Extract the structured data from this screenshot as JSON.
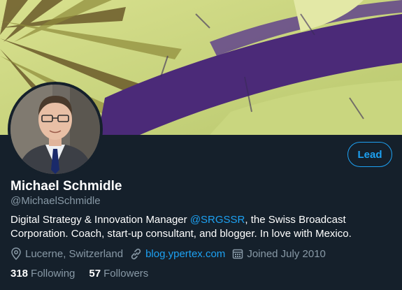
{
  "profile": {
    "name": "Michael Schmidle",
    "handle": "@MichaelSchmidle",
    "bio_before": "Digital Strategy & Innovation Manager ",
    "bio_mention": "@SRGSSR",
    "bio_after": ", the Swiss Broadcast Corporation. Coach, start-up consultant, and blogger. In love with Mexico.",
    "location": "Lucerne, Switzerland",
    "website": "blog.ypertex.com",
    "joined": "Joined July 2010"
  },
  "actions": {
    "lead_label": "Lead"
  },
  "stats": {
    "following_count": "318",
    "following_label": "Following",
    "followers_count": "57",
    "followers_label": "Followers"
  },
  "colors": {
    "background": "#15202b",
    "accent": "#1da1f2",
    "muted": "#8899a6",
    "banner_green": "#c5d27a",
    "banner_purple": "#4b2a78"
  },
  "icons": {
    "location": "location-pin-icon",
    "link": "link-icon",
    "calendar": "calendar-icon"
  }
}
